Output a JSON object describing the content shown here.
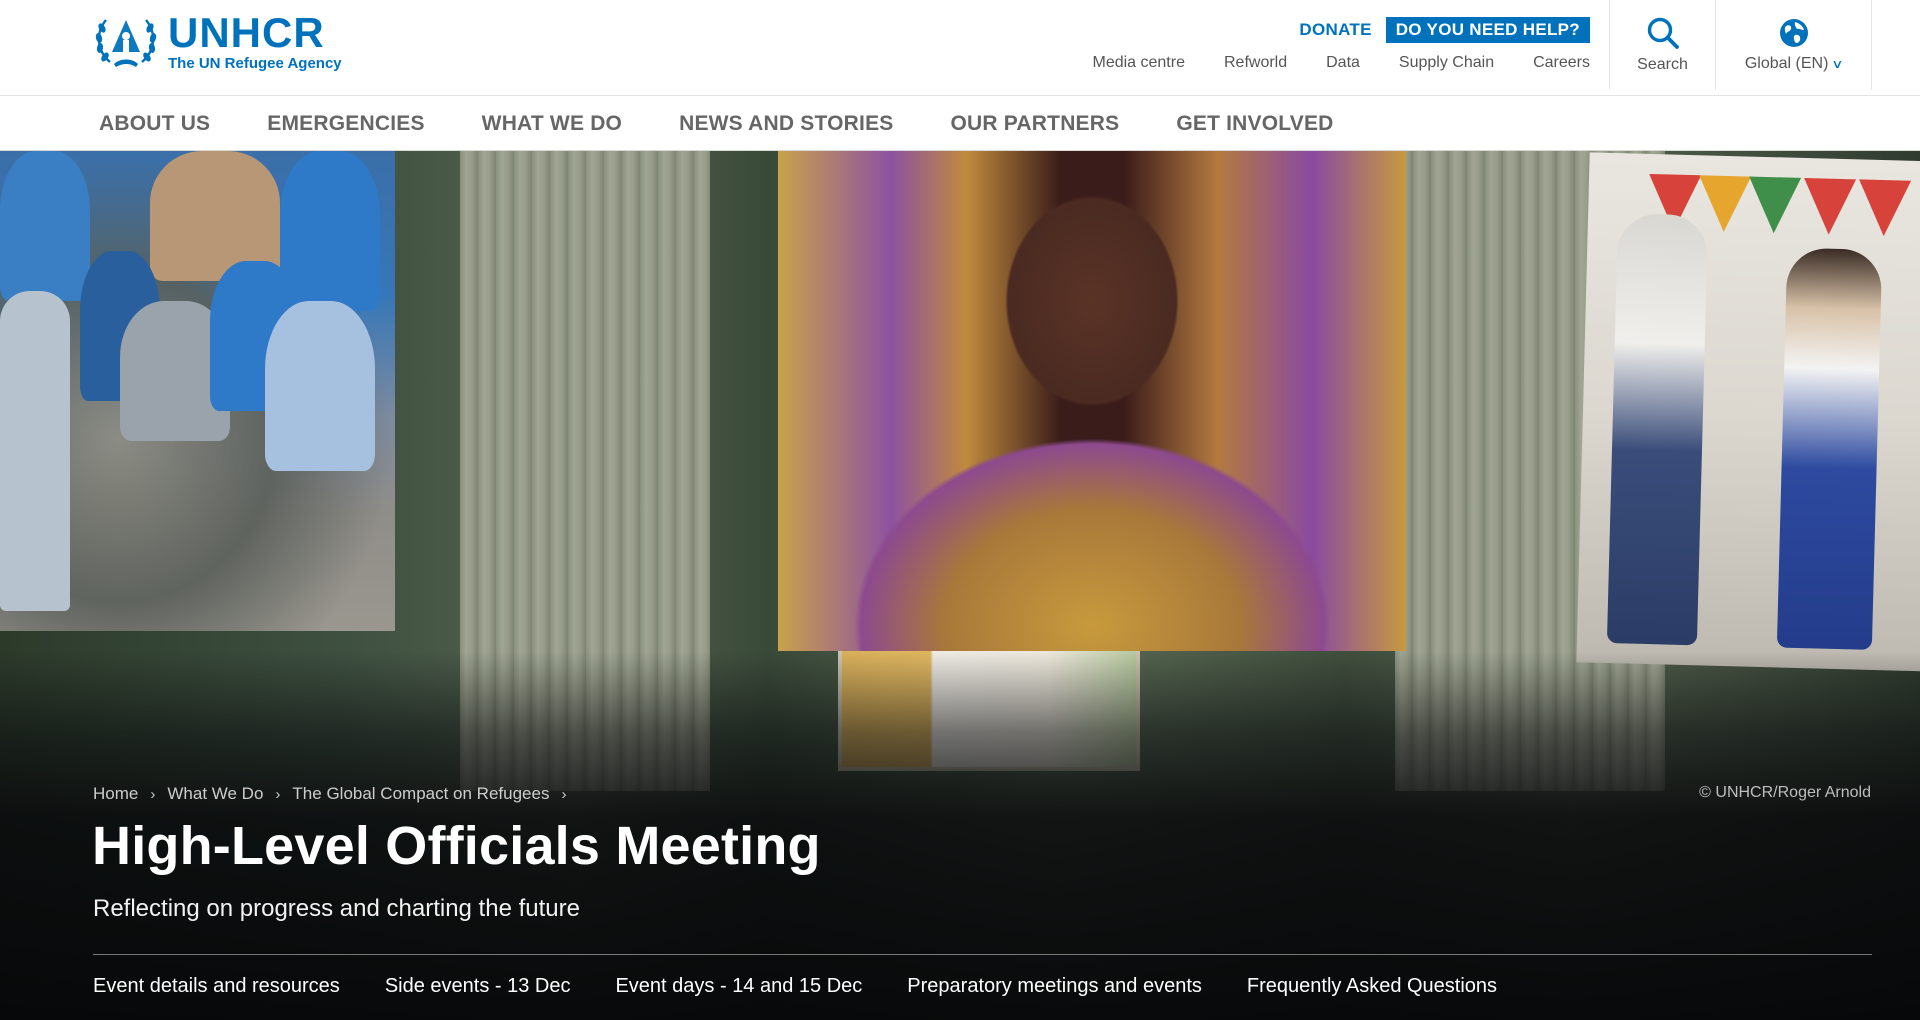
{
  "header": {
    "logo": {
      "name": "UNHCR",
      "tagline": "The UN Refugee Agency"
    },
    "donate_label": "DONATE",
    "help_label": "DO YOU NEED HELP?",
    "utility_links": [
      "Media centre",
      "Refworld",
      "Data",
      "Supply Chain",
      "Careers"
    ],
    "search_label": "Search",
    "language_label": "Global (EN)",
    "icons": [
      "search-icon",
      "globe-icon",
      "chevron-down-icon"
    ]
  },
  "nav": {
    "items": [
      "ABOUT US",
      "EMERGENCIES",
      "WHAT WE DO",
      "NEWS AND STORIES",
      "OUR PARTNERS",
      "GET INVOLVED"
    ]
  },
  "hero": {
    "breadcrumb": [
      "Home",
      "What We Do",
      "The Global Compact on Refugees"
    ],
    "credit": "© UNHCR/Roger Arnold",
    "title": "High-Level Officials Meeting",
    "subtitle": "Reflecting on progress and charting the future",
    "subnav": [
      "Event details and resources",
      "Side events - 13 Dec",
      "Event days - 14 and 15 Dec",
      "Preparatory meetings and events",
      "Frequently Asked Questions"
    ]
  },
  "colors": {
    "brand": "#0072bc",
    "nav_text": "#666666",
    "hero_overlay": "#08090b"
  }
}
